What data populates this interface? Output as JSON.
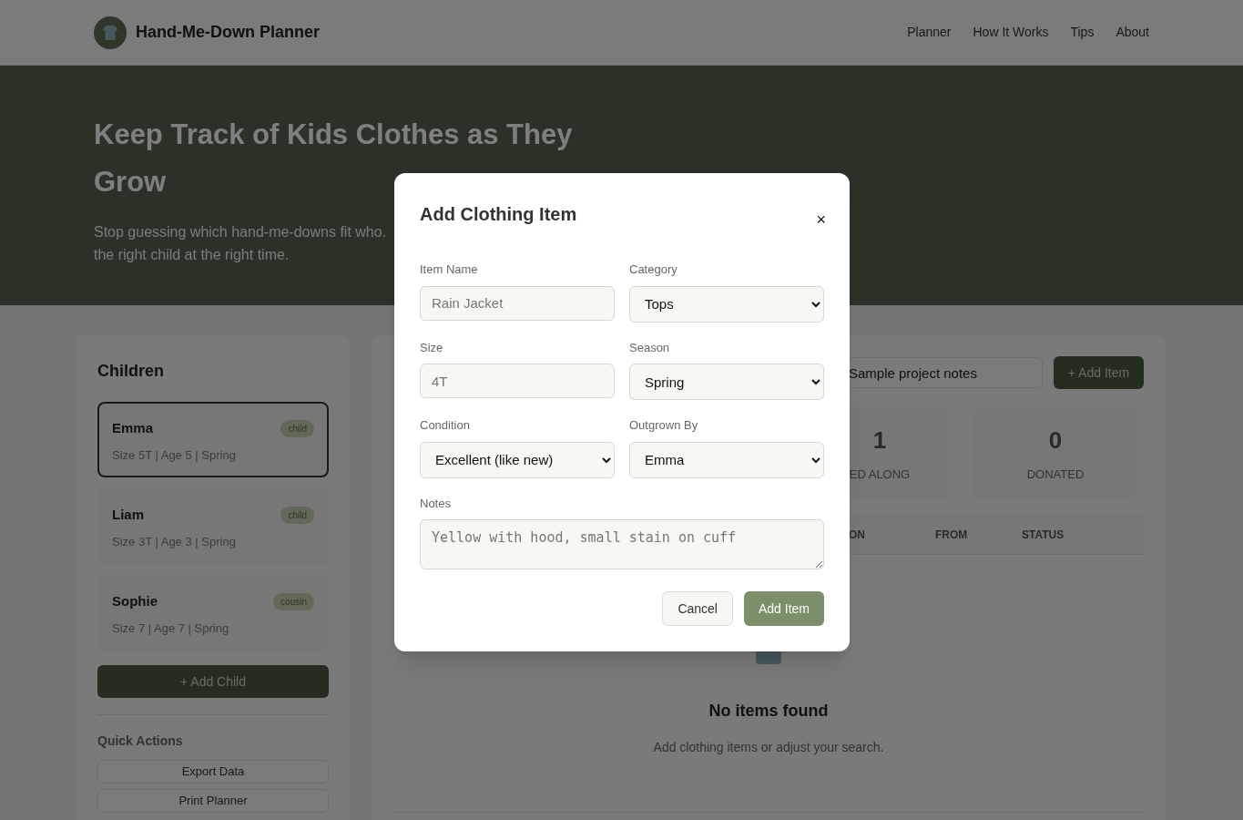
{
  "header": {
    "brand": "Hand-Me-Down Planner",
    "nav": [
      {
        "label": "Planner"
      },
      {
        "label": "How It Works"
      },
      {
        "label": "Tips"
      },
      {
        "label": "About"
      }
    ]
  },
  "hero": {
    "title": "Keep Track of Kids Clothes as They Grow",
    "subtitle_lines": [
      "Stop guessing which hand-me-downs fit who.",
      "the right child at the right time."
    ]
  },
  "sidebar": {
    "title": "Children",
    "children": [
      {
        "name": "Emma",
        "badge": "child",
        "color": "#62695b",
        "details": "Size 5T | Age 5 | Spring",
        "selected": true
      },
      {
        "name": "Liam",
        "badge": "child",
        "color": "#62695b",
        "details": "Size 3T | Age 3 | Spring",
        "selected": false
      },
      {
        "name": "Sophie",
        "badge": "cousin",
        "color": "#656859",
        "details": "Size 7 | Age 7 | Spring",
        "selected": false
      }
    ],
    "add_button": "+ Add Child",
    "quick_actions_title": "Quick Actions",
    "quick_actions": [
      "Export Data",
      "Print Planner"
    ]
  },
  "main": {
    "search_value": "Sample project notes",
    "add_button": "+ Add Item",
    "stats": [
      {
        "value": "1",
        "label": "ED ALONG"
      },
      {
        "value": "0",
        "label": "DONATED"
      }
    ],
    "columns": [
      "ON",
      "FROM",
      "STATUS"
    ],
    "empty_title": "No items found",
    "empty_text": "Add clothing items or adjust your search."
  },
  "modal": {
    "title": "Add Clothing Item",
    "close": "×",
    "fields": [
      {
        "kind": "text",
        "label": "Item Name",
        "placeholder": "Rain Jacket"
      },
      {
        "kind": "select",
        "label": "Category",
        "value": "Tops"
      },
      {
        "kind": "text",
        "label": "Size",
        "placeholder": "4T"
      },
      {
        "kind": "select",
        "label": "Season",
        "value": "Spring"
      },
      {
        "kind": "select",
        "label": "Condition",
        "value": "Excellent (like new)"
      },
      {
        "kind": "select",
        "label": "Outgrown By",
        "value": "Emma"
      },
      {
        "kind": "textarea",
        "label": "Notes",
        "placeholder": "Yellow with hood, small stain on cuff"
      }
    ],
    "cancel": "Cancel",
    "submit": "Add Item"
  }
}
